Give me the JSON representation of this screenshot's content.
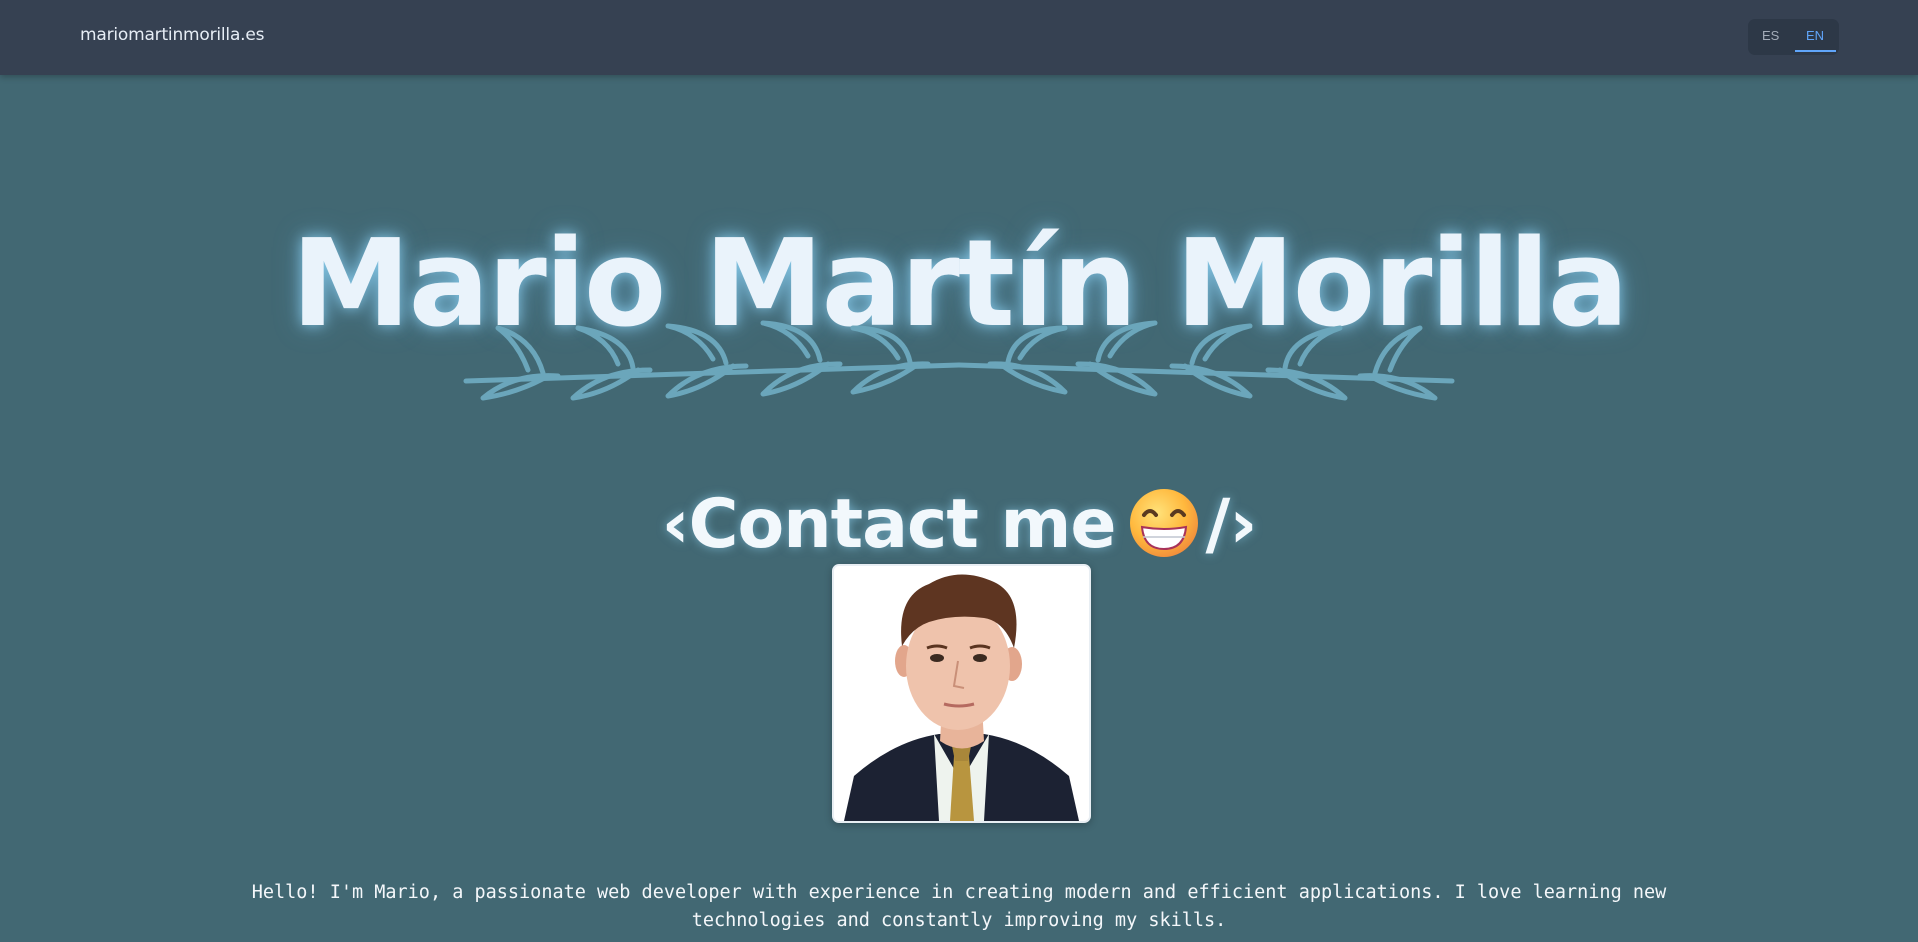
{
  "header": {
    "site_name": "mariomartinmorilla.es",
    "languages": [
      "ES",
      "EN"
    ],
    "active_language": "EN"
  },
  "hero": {
    "name": "Mario Martín Morilla",
    "contact_prefix": "‹Contact me",
    "contact_suffix": "/›",
    "emoji": "beaming-grin-emoji"
  },
  "profile": {
    "photo": "profile-photo"
  },
  "bio": {
    "text": "Hello! I'm Mario, a passionate web developer with experience in creating modern and efficient applications. I love learning new technologies and constantly improving my skills."
  },
  "colors": {
    "background": "#426873",
    "header": "#364152",
    "accent": "#60a5fa",
    "laurel": "#6ba6bb",
    "title_text": "#eaf3fb"
  }
}
